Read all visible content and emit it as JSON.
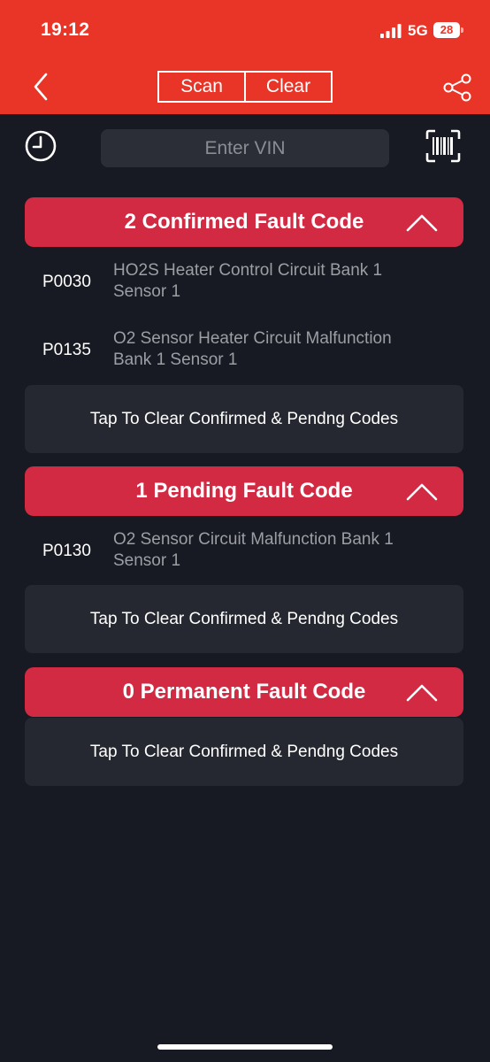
{
  "status_bar": {
    "time": "19:12",
    "network": "5G",
    "battery": "28"
  },
  "toolbar": {
    "scan_label": "Scan",
    "clear_label": "Clear"
  },
  "search": {
    "placeholder": "Enter VIN"
  },
  "sections": [
    {
      "title": "2 Confirmed Fault Code",
      "codes": [
        {
          "code": "P0030",
          "description": "HO2S Heater Control Circuit Bank 1 Sensor 1"
        },
        {
          "code": "P0135",
          "description": "O2 Sensor Heater Circuit Malfunction Bank 1 Sensor 1"
        }
      ],
      "clear_label": "Tap To Clear Confirmed & Pendng Codes"
    },
    {
      "title": "1 Pending Fault Code",
      "codes": [
        {
          "code": "P0130",
          "description": "O2 Sensor Circuit Malfunction Bank 1 Sensor 1"
        }
      ],
      "clear_label": "Tap To Clear Confirmed & Pendng Codes"
    },
    {
      "title": "0 Permanent Fault Code",
      "codes": [],
      "clear_label": "Tap To Clear Confirmed & Pendng Codes"
    }
  ],
  "colors": {
    "header": "#e83528",
    "section_header": "#d22a43",
    "background": "#171a22",
    "card": "#252830"
  },
  "icons": [
    "chevron-left-icon",
    "share-icon",
    "clock-icon",
    "barcode-scan-icon",
    "chevron-up-icon"
  ]
}
